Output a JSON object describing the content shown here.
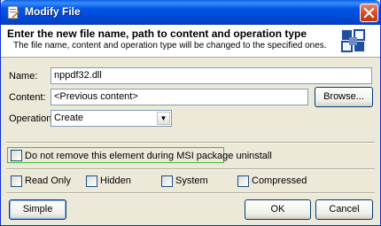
{
  "window": {
    "title": "Modify File"
  },
  "header": {
    "title": "Enter the new file name, path to content and operation type",
    "subtitle": "The file name, content and operation type will be changed to the specified ones."
  },
  "form": {
    "name_label": "Name:",
    "name_value": "nppdf32.dll",
    "content_label": "Content:",
    "content_value": "<Previous content>",
    "browse_label": "Browse...",
    "operation_label": "Operation:",
    "operation_value": "Create"
  },
  "options": {
    "msi_uninstall_label": "Do not remove this element during MSI package uninstall",
    "read_only_label": "Read Only",
    "hidden_label": "Hidden",
    "system_label": "System",
    "compressed_label": "Compressed"
  },
  "footer": {
    "simple_label": "Simple",
    "ok_label": "OK",
    "cancel_label": "Cancel"
  },
  "colors": {
    "titlebar": "#0054e3",
    "dialog_face": "#ece9d8",
    "field_border": "#7f9db9",
    "msi_highlight": "#3fbf3f"
  },
  "icons": {
    "app": "document-edit-icon",
    "close": "close-icon",
    "header": "squares-logo-icon",
    "dropdown": "chevron-down-icon"
  }
}
